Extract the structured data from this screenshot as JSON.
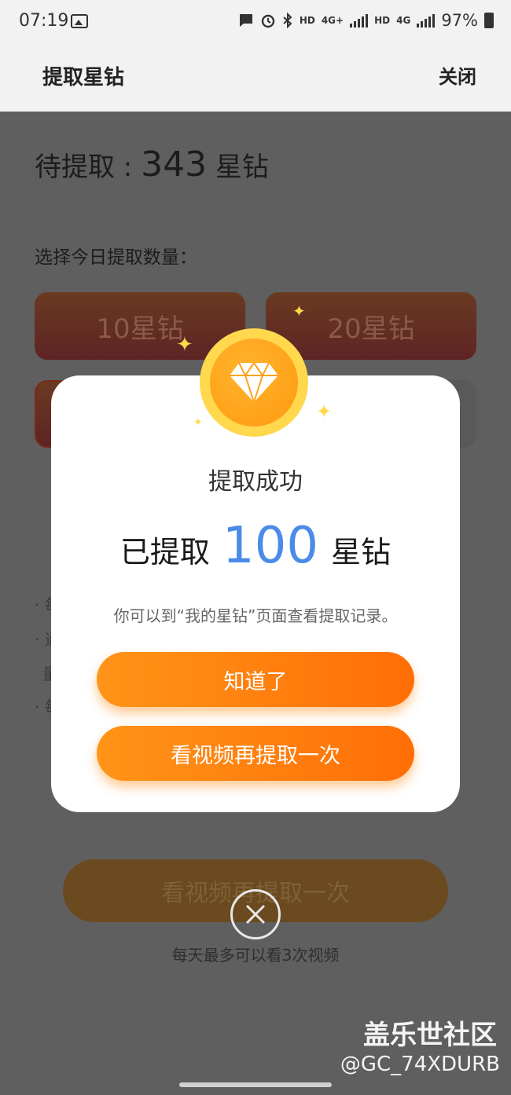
{
  "status": {
    "time": "07:19",
    "hd1": "HD",
    "net1": "4G+",
    "hd2": "HD",
    "net2": "4G",
    "battery": "97%"
  },
  "header": {
    "title": "提取星钻",
    "close": "关闭"
  },
  "page": {
    "pending_label": "待提取 : ",
    "pending_amount": "343",
    "pending_unit": " 星钻",
    "select_label": "选择今日提取数量：",
    "options": [
      "10星钻",
      "20星钻"
    ],
    "rules": [
      "· 每",
      "· 通",
      "量",
      "· 每"
    ],
    "video_button": "看视频再提取一次",
    "video_hint": "每天最多可以看3次视频"
  },
  "dialog": {
    "title": "提取成功",
    "amount_prefix": "已提取",
    "amount": "100",
    "amount_unit": "星钻",
    "description": "你可以到“我的星钻”页面查看提取记录。",
    "ok_button": "知道了",
    "again_button": "看视频再提取一次",
    "icon": "diamond-icon"
  },
  "watermark": {
    "line1": "盖乐世社区",
    "line2": "@GC_74XDURB"
  },
  "colors": {
    "accent_blue": "#4a8be8",
    "button_orange": "#ff7a0c",
    "medal_yellow": "#ffd84e"
  }
}
